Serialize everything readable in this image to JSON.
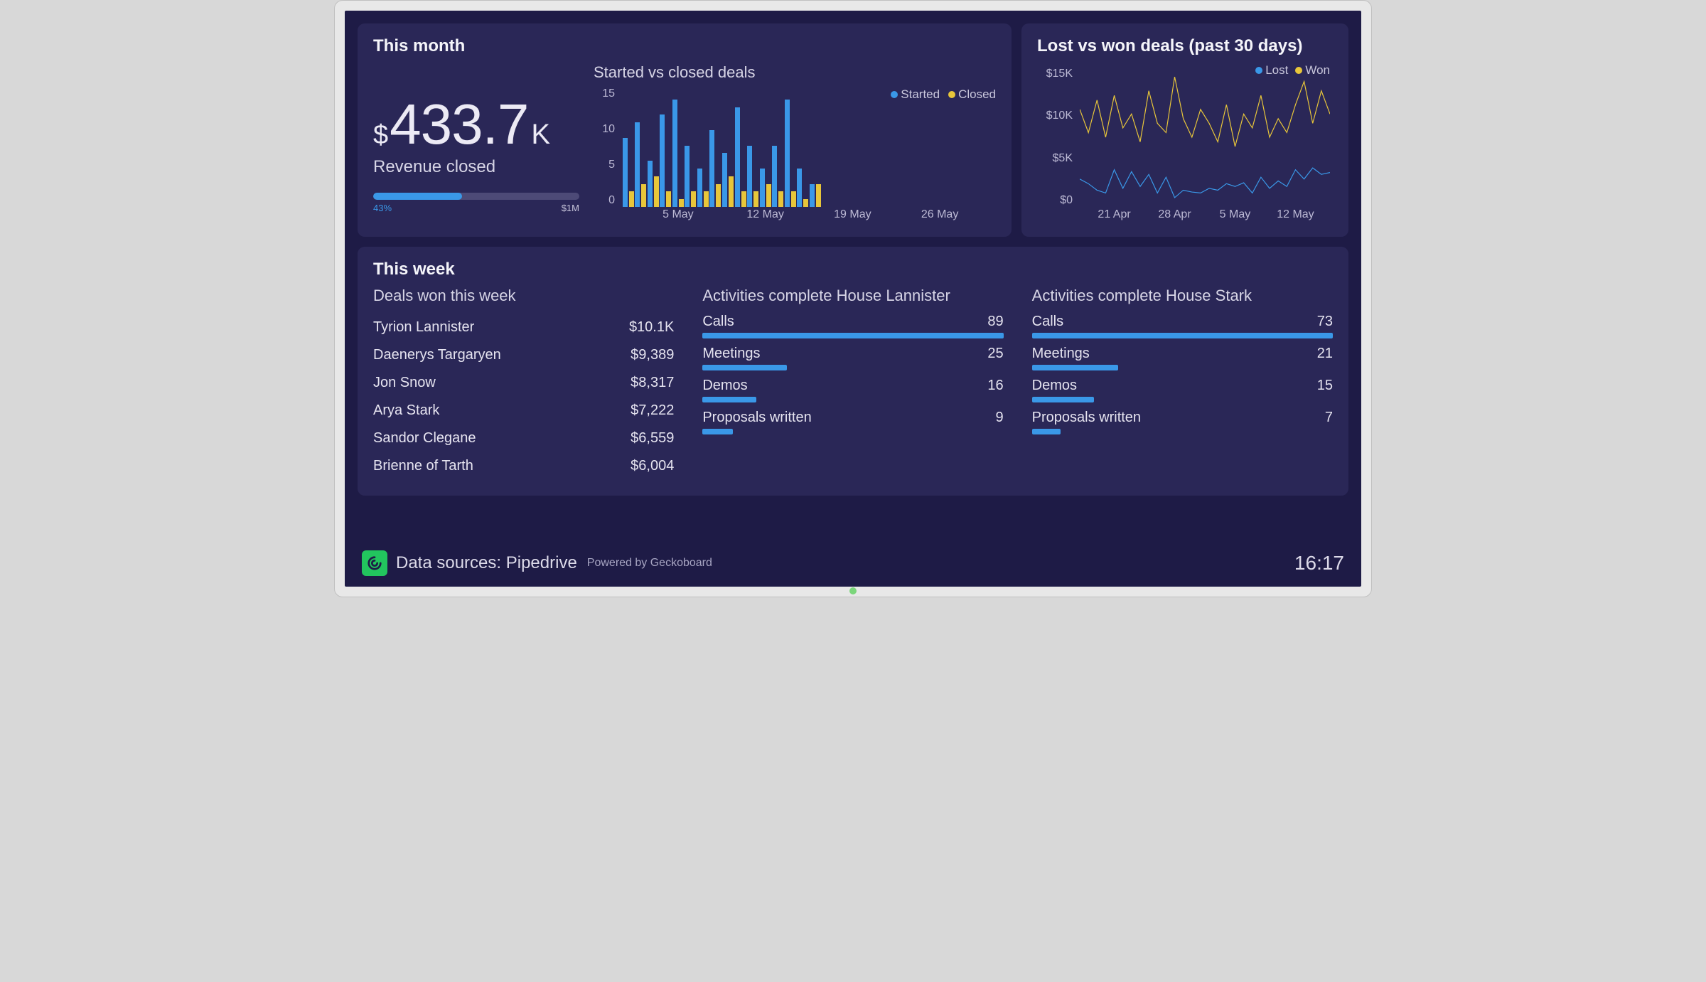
{
  "colors": {
    "blue": "#3a98e8",
    "yellow": "#e8c63a"
  },
  "month": {
    "title": "This month",
    "revenue": {
      "currency": "$",
      "main": "433.7",
      "suffix": "K",
      "label": "Revenue closed",
      "progress_pct": 43,
      "progress_pct_label": "43%",
      "goal_label": "$1M"
    },
    "bar_chart_title": "Started vs closed deals",
    "legend": {
      "started": "Started",
      "closed": "Closed"
    }
  },
  "lostwon": {
    "title": "Lost vs won deals (past 30 days)",
    "legend": {
      "lost": "Lost",
      "won": "Won"
    }
  },
  "week": {
    "title": "This week",
    "deals_title": "Deals won this week",
    "deals": [
      {
        "name": "Tyrion Lannister",
        "value": "$10.1K"
      },
      {
        "name": "Daenerys Targaryen",
        "value": "$9,389"
      },
      {
        "name": "Jon Snow",
        "value": "$8,317"
      },
      {
        "name": "Arya Stark",
        "value": "$7,222"
      },
      {
        "name": "Sandor Clegane",
        "value": "$6,559"
      },
      {
        "name": "Brienne of Tarth",
        "value": "$6,004"
      }
    ],
    "activities": [
      {
        "title": "Activities complete House Lannister",
        "rows": [
          {
            "label": "Calls",
            "value": 89
          },
          {
            "label": "Meetings",
            "value": 25
          },
          {
            "label": "Demos",
            "value": 16
          },
          {
            "label": "Proposals written",
            "value": 9
          }
        ]
      },
      {
        "title": "Activities complete House Stark",
        "rows": [
          {
            "label": "Calls",
            "value": 73
          },
          {
            "label": "Meetings",
            "value": 21
          },
          {
            "label": "Demos",
            "value": 15
          },
          {
            "label": "Proposals written",
            "value": 7
          }
        ]
      }
    ]
  },
  "footer": {
    "main": "Data sources: Pipedrive",
    "sub": "Powered by Geckoboard",
    "clock": "16:17"
  },
  "chart_data": [
    {
      "type": "bar",
      "title": "Started vs closed deals",
      "xlabel": "",
      "ylabel": "",
      "ylim": [
        0,
        15
      ],
      "y_ticks": [
        15,
        10,
        5,
        0
      ],
      "x_tick_labels": [
        "5 May",
        "12 May",
        "19 May",
        "26 May"
      ],
      "x_tick_positions": [
        4,
        11,
        18,
        25
      ],
      "categories": [
        0,
        1,
        2,
        3,
        4,
        5,
        6,
        7,
        8,
        9,
        10,
        11,
        12,
        13,
        14,
        15,
        16,
        17,
        18,
        19,
        20,
        21,
        22,
        23,
        24,
        25,
        26,
        27,
        28,
        29
      ],
      "series": [
        {
          "name": "Started",
          "values": [
            9,
            11,
            6,
            12,
            14,
            8,
            5,
            10,
            7,
            13,
            8,
            5,
            8,
            14,
            5,
            3,
            0,
            0,
            0,
            0,
            0,
            0,
            0,
            0,
            0,
            0,
            0,
            0,
            0,
            0
          ]
        },
        {
          "name": "Closed",
          "values": [
            2,
            3,
            4,
            2,
            1,
            2,
            2,
            3,
            4,
            2,
            2,
            3,
            2,
            2,
            1,
            3,
            0,
            0,
            0,
            0,
            0,
            0,
            0,
            0,
            0,
            0,
            0,
            0,
            0,
            0
          ]
        }
      ]
    },
    {
      "type": "line",
      "title": "Lost vs won deals (past 30 days)",
      "xlabel": "",
      "ylabel": "",
      "ylim": [
        0,
        15000
      ],
      "y_ticks": [
        "$15K",
        "$10K",
        "$5K",
        "$0"
      ],
      "x_tick_labels": [
        "21 Apr",
        "28 Apr",
        "5 May",
        "12 May"
      ],
      "x_tick_positions": [
        4,
        11,
        18,
        25
      ],
      "x": [
        0,
        1,
        2,
        3,
        4,
        5,
        6,
        7,
        8,
        9,
        10,
        11,
        12,
        13,
        14,
        15,
        16,
        17,
        18,
        19,
        20,
        21,
        22,
        23,
        24,
        25,
        26,
        27,
        28,
        29
      ],
      "series": [
        {
          "name": "Lost",
          "values": [
            3000,
            2500,
            1800,
            1500,
            4000,
            2000,
            3800,
            2200,
            3500,
            1500,
            3200,
            1000,
            1800,
            1600,
            1500,
            2000,
            1800,
            2500,
            2200,
            2600,
            1500,
            3200,
            2000,
            2800,
            2200,
            4000,
            3000,
            4200,
            3500,
            3700
          ]
        },
        {
          "name": "Won",
          "values": [
            10500,
            8000,
            11500,
            7500,
            12000,
            8500,
            10000,
            7000,
            12500,
            9000,
            8000,
            14000,
            9500,
            7500,
            10500,
            9000,
            7000,
            11000,
            6500,
            10000,
            8500,
            12000,
            7500,
            9500,
            8000,
            11000,
            13500,
            9000,
            12500,
            10000
          ]
        }
      ]
    }
  ]
}
